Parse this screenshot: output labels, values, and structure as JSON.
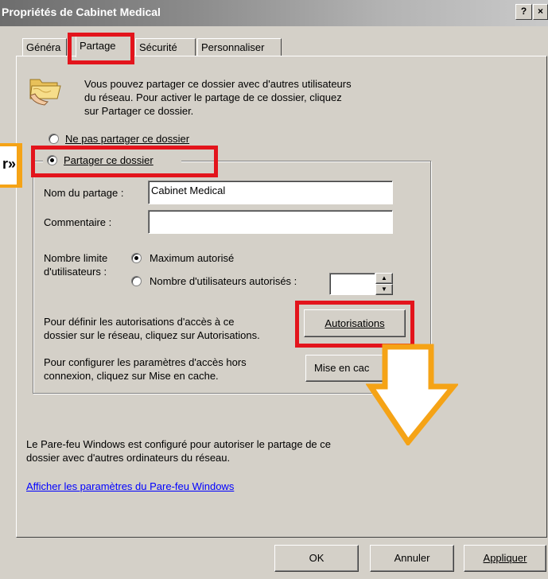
{
  "window": {
    "title": "Propriétés de Cabinet Medical",
    "help_label": "?",
    "close_label": "×"
  },
  "tabs": [
    {
      "label": "Généra"
    },
    {
      "label": "Partage"
    },
    {
      "label": "Sécurité"
    },
    {
      "label": "Personnaliser"
    }
  ],
  "intro": {
    "line1": "Vous pouvez partager ce dossier avec d'autres utilisateurs",
    "line2": "du réseau. Pour activer le partage de ce dossier, cliquez",
    "line3": "sur Partager ce dossier."
  },
  "sharing": {
    "no_share_label": "Ne pas partager ce dossier",
    "share_label": "Partager ce dossier",
    "selected": "share"
  },
  "share_name": {
    "label": "Nom du partage :",
    "value": "Cabinet Medical"
  },
  "comment": {
    "label": "Commentaire :",
    "value": ""
  },
  "user_limit": {
    "label_line1": "Nombre limite",
    "label_line2": "d'utilisateurs :",
    "max_label": "Maximum autorisé",
    "count_label": "Nombre d'utilisateurs autorisés :",
    "selected": "max",
    "spinner_value": ""
  },
  "permissions": {
    "text_line1": "Pour définir les autorisations d'accès à ce",
    "text_line2": "dossier sur le réseau, cliquez sur Autorisations.",
    "button_label": "Autorisations"
  },
  "caching": {
    "text_line1": "Pour configurer les paramètres d'accès hors",
    "text_line2": "connexion, cliquez sur Mise en cache.",
    "button_label": "Mise en cac"
  },
  "firewall": {
    "line1": "Le Pare-feu Windows est configuré pour autoriser le partage de ce",
    "line2": "dossier avec d'autres ordinateurs du réseau.",
    "link_label": "Afficher les paramètres du Pare-feu Windows"
  },
  "footer": {
    "ok_label": "OK",
    "cancel_label": "Annuler",
    "apply_label": "Appliquer"
  },
  "annotations": {
    "callout_text": "r»",
    "highlight_color": "#e3141c",
    "arrow_color": "#f5a316"
  }
}
